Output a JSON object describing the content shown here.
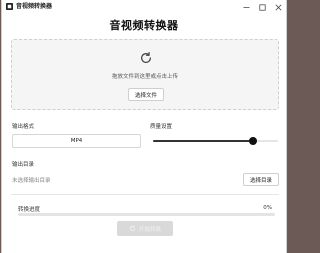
{
  "window": {
    "title": "音视频转换器"
  },
  "main": {
    "title": "音视频转换器"
  },
  "dropzone": {
    "icon": "refresh-icon",
    "hint": "拖放文件到这里或点击上传",
    "choose_file_label": "选择文件"
  },
  "format": {
    "label": "输出格式",
    "selected": "MP4"
  },
  "quality": {
    "label": "质量设置",
    "value_fraction": 0.8
  },
  "output": {
    "label": "输出目录",
    "status": "未选择输出目录",
    "choose_dir_label": "选择目录"
  },
  "progress": {
    "label": "转换进度",
    "percent_text": "0%",
    "value": 0
  },
  "start": {
    "label": "开始转换",
    "icon": "refresh-icon"
  },
  "colors": {
    "background": "#6b5a55",
    "window": "#ffffff",
    "accent": "#111111",
    "disabled_button": "#d9d9d9"
  }
}
